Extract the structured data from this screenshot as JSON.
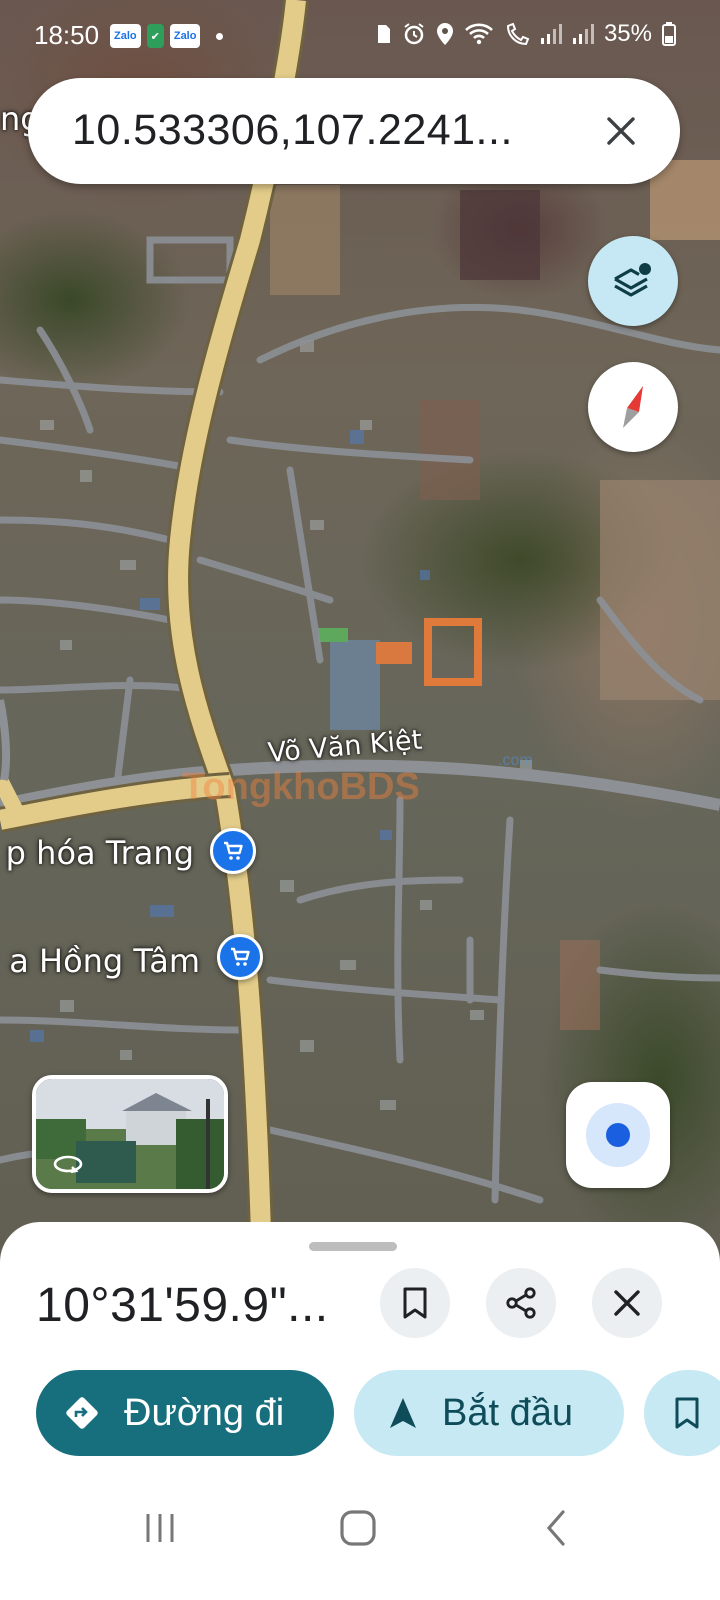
{
  "status_bar": {
    "time": "18:50",
    "notifications": [
      "Zalo",
      "✔",
      "Zalo"
    ],
    "battery": "35%"
  },
  "search": {
    "query": "10.533306,107.2241..."
  },
  "map": {
    "street_label": "Võ Văn Kiệt",
    "pois": [
      {
        "label": "p hóa Trang",
        "icon": "shopping-cart-icon"
      },
      {
        "label": "a Hồng Tâm",
        "icon": "shopping-cart-icon"
      }
    ],
    "partial_label": "ng",
    "watermark": "TongkhoBDS",
    "watermark_sub": ".com"
  },
  "sheet": {
    "title": "10°31'59.9\"...",
    "actions": {
      "directions": "Đường đi",
      "start": "Bắt đầu"
    }
  },
  "colors": {
    "accent": "#176f7e",
    "chip_light": "#c7e9f3",
    "poi_blue": "#1a73e8",
    "road": "#e3cc8a"
  }
}
